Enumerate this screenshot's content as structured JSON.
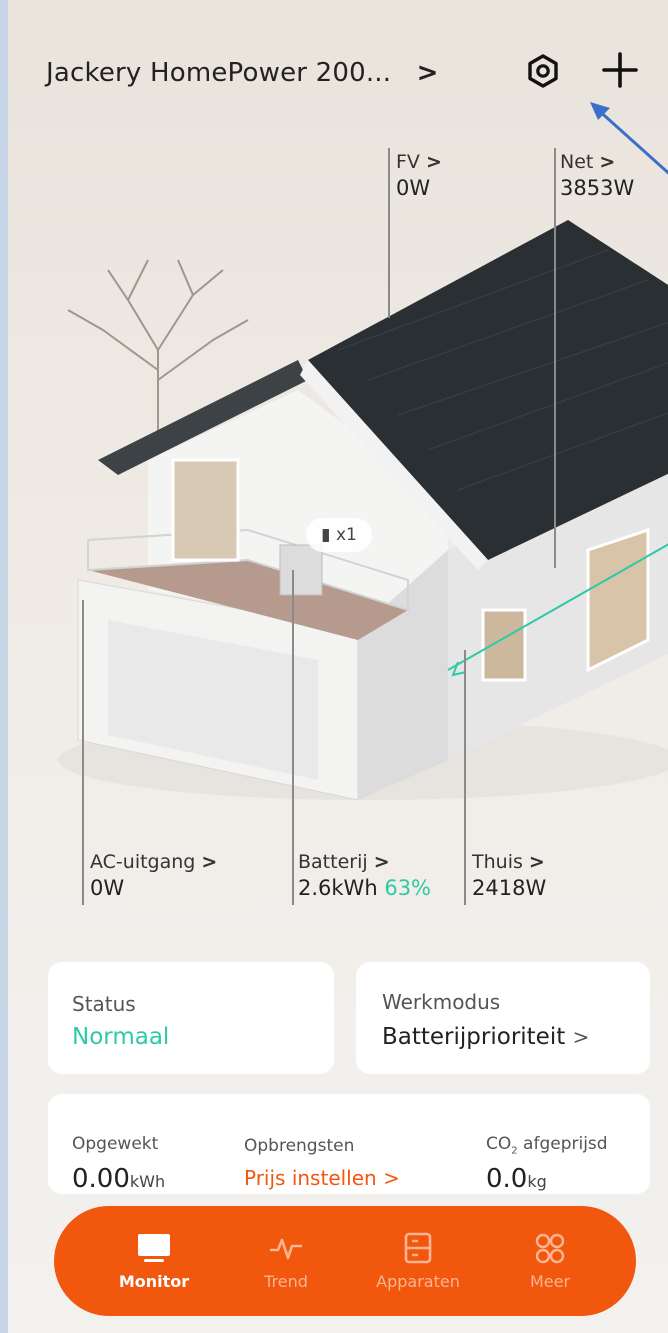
{
  "header": {
    "title": "Jackery HomePower 200...",
    "title_chevron": ">"
  },
  "icons": {
    "settings": "hexagon-gear-icon",
    "add": "plus-icon",
    "annotation": "blue-arrow-pointer"
  },
  "diagram": {
    "fv": {
      "label": "FV",
      "chevron": ">",
      "value": "0W"
    },
    "net": {
      "label": "Net",
      "chevron": ">",
      "value": "3853W"
    },
    "battery_badge": "x1",
    "ac": {
      "label": "AC-uitgang",
      "chevron": ">",
      "value": "0W"
    },
    "battery": {
      "label": "Batterij",
      "chevron": ">",
      "value": "2.6kWh",
      "percent": "63%"
    },
    "home": {
      "label": "Thuis",
      "chevron": ">",
      "value": "2418W"
    }
  },
  "status_card": {
    "label": "Status",
    "value": "Normaal"
  },
  "mode_card": {
    "label": "Werkmodus",
    "value": "Batterijprioriteit",
    "chevron": ">"
  },
  "stats": {
    "generated": {
      "label": "Opgewekt",
      "value": "0.00",
      "unit": "kWh"
    },
    "earnings": {
      "label": "Opbrengsten",
      "value": "Prijs instellen",
      "chevron": ">"
    },
    "co2": {
      "label_prefix": "CO",
      "label_sub": "2",
      "label_suffix": " afgeprijsd",
      "value": "0.0",
      "unit": "kg"
    }
  },
  "nav": [
    {
      "label": "Monitor",
      "icon": "monitor-icon",
      "active": true
    },
    {
      "label": "Trend",
      "icon": "pulse-icon",
      "active": false
    },
    {
      "label": "Apparaten",
      "icon": "devices-icon",
      "active": false
    },
    {
      "label": "Meer",
      "icon": "grid-icon",
      "active": false
    }
  ],
  "colors": {
    "accent": "#f2570e",
    "positive": "#2ec9a6"
  }
}
